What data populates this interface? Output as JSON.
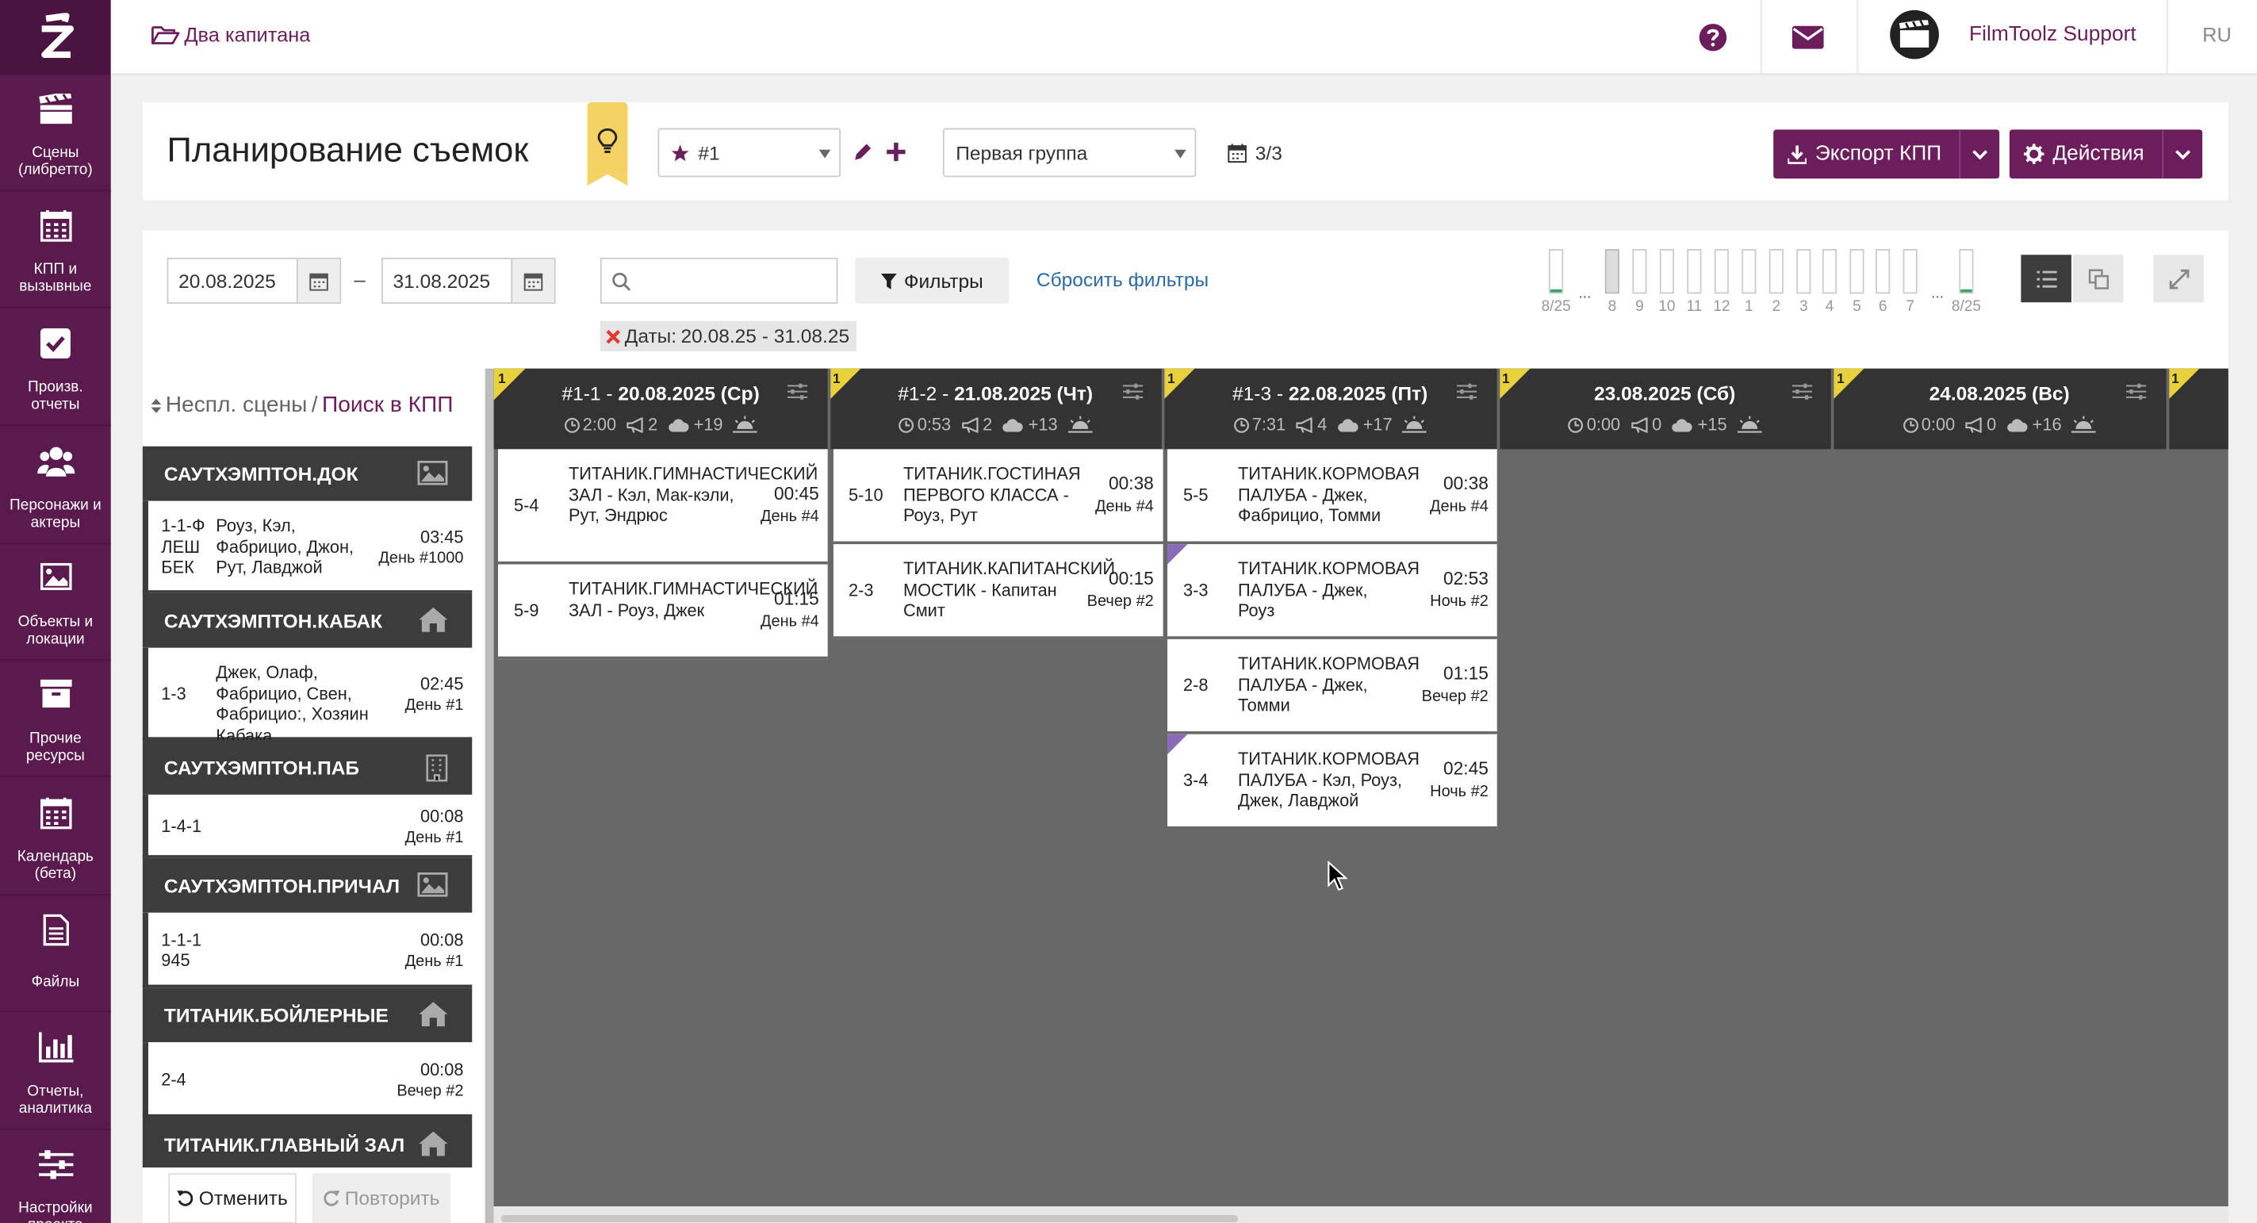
{
  "app": {
    "project": "Два капитана",
    "user": "FilmToolz Support",
    "lang": "RU"
  },
  "nav": [
    {
      "label": "Сцены (либретто)",
      "icon": "clapperboard-icon"
    },
    {
      "label": "КПП и вызывные",
      "icon": "calendar-grid-icon"
    },
    {
      "label": "Произв. отчеты",
      "icon": "checkbox-icon"
    },
    {
      "label": "Персонажи и актеры",
      "icon": "people-icon"
    },
    {
      "label": "Объекты и локации",
      "icon": "image-icon"
    },
    {
      "label": "Прочие ресурсы",
      "icon": "archive-icon"
    },
    {
      "label": "Календарь (бета)",
      "icon": "calendar-icon"
    },
    {
      "label": "Файлы",
      "icon": "file-icon"
    },
    {
      "label": "Отчеты, аналитика",
      "icon": "bar-chart-icon"
    },
    {
      "label": "Настройки проекта",
      "icon": "sliders-icon"
    }
  ],
  "header": {
    "title": "Планирование съемок",
    "version": "#1",
    "group": "Первая группа",
    "days_count": "3/3",
    "export_label": "Экспорт КПП",
    "actions_label": "Действия"
  },
  "toolbar": {
    "date_from": "20.08.2025",
    "date_dash": "–",
    "date_to": "31.08.2025",
    "search_placeholder": "",
    "filters_label": "Фильтры",
    "reset_label": "Сбросить фильтры",
    "chip_label": "Даты:",
    "chip_value": "20.08.25 - 31.08.25",
    "minimap_labels": [
      "8/25",
      "8",
      "9",
      "10",
      "11",
      "12",
      "1",
      "2",
      "3",
      "4",
      "5",
      "6",
      "7",
      "8/25"
    ],
    "minimap_ellipsis": "..."
  },
  "unplaced": {
    "title": "Неспл. сцены",
    "sep": "/",
    "link": "Поиск в КПП",
    "groups": [
      {
        "name": "САУТХЭМПТОН.ДОК",
        "icon": "image-icon",
        "items": [
          {
            "num": "1-1-Ф ЛЕШ БЕК",
            "desc": "Роуз, Кэл, Фабрицио, Джон, Рут, Лавджой",
            "time": "03:45",
            "tod": "День #1000"
          }
        ]
      },
      {
        "name": "САУТХЭМПТОН.КАБАК",
        "icon": "home-icon",
        "items": [
          {
            "num": "1-3",
            "desc": "Джек, Олаф, Фабрицио, Свен, Фабрицио:, Хозяин Кабака",
            "time": "02:45",
            "tod": "День #1"
          }
        ]
      },
      {
        "name": "САУТХЭМПТОН.ПАБ",
        "icon": "building-icon",
        "items": [
          {
            "num": "1-4-1",
            "desc": "",
            "time": "00:08",
            "tod": "День #1"
          }
        ]
      },
      {
        "name": "САУТХЭМПТОН.ПРИЧАЛ",
        "icon": "image-icon",
        "items": [
          {
            "num": "1-1-1 945",
            "desc": "",
            "time": "00:08",
            "tod": "День #1"
          }
        ]
      },
      {
        "name": "ТИТАНИК.БОЙЛЕРНЫЕ",
        "icon": "home-icon",
        "items": [
          {
            "num": "2-4",
            "desc": "",
            "time": "00:08",
            "tod": "Вечер #2"
          }
        ]
      },
      {
        "name": "ТИТАНИК.ГЛАВНЫЙ ЗАЛ",
        "icon": "home-icon",
        "items": []
      }
    ],
    "undo_label": "Отменить",
    "redo_label": "Повторить"
  },
  "days": [
    {
      "badge": "1",
      "prefix": "#1-1 - ",
      "date": "20.08.2025 (Ср)",
      "duration": "2:00",
      "scenes": "2",
      "weather": "+19",
      "cards": [
        {
          "num": "5-4",
          "desc": "ТИТАНИК.ГИМНАСТИЧЕСКИЙ ЗАЛ - Кэл, Мак-кэли, Рут, Эндрюс",
          "time": "00:45",
          "tod": "День #4",
          "mark": false
        },
        {
          "num": "5-9",
          "desc": "ТИТАНИК.ГИМНАСТИЧЕСКИЙ ЗАЛ - Роуз, Джек",
          "time": "01:15",
          "tod": "День #4",
          "mark": false
        }
      ]
    },
    {
      "badge": "1",
      "prefix": "#1-2 - ",
      "date": "21.08.2025 (Чт)",
      "duration": "0:53",
      "scenes": "2",
      "weather": "+13",
      "cards": [
        {
          "num": "5-10",
          "desc": "ТИТАНИК.ГОСТИНАЯ ПЕРВОГО КЛАССА - Роуз, Рут",
          "time": "00:38",
          "tod": "День #4",
          "mark": false
        },
        {
          "num": "2-3",
          "desc": "ТИТАНИК.КАПИТАНСКИЙ МОСТИК - Капитан Смит",
          "time": "00:15",
          "tod": "Вечер #2",
          "mark": false
        }
      ]
    },
    {
      "badge": "1",
      "prefix": "#1-3 - ",
      "date": "22.08.2025 (Пт)",
      "duration": "7:31",
      "scenes": "4",
      "weather": "+17",
      "cards": [
        {
          "num": "5-5",
          "desc": "ТИТАНИК.КОРМОВАЯ ПАЛУБА - Джек, Фабрицио, Томми",
          "time": "00:38",
          "tod": "День #4",
          "mark": false
        },
        {
          "num": "3-3",
          "desc": "ТИТАНИК.КОРМОВАЯ ПАЛУБА - Джек, Роуз",
          "time": "02:53",
          "tod": "Ночь #2",
          "mark": true
        },
        {
          "num": "2-8",
          "desc": "ТИТАНИК.КОРМОВАЯ ПАЛУБА - Джек, Томми",
          "time": "01:15",
          "tod": "Вечер #2",
          "mark": false
        },
        {
          "num": "3-4",
          "desc": "ТИТАНИК.КОРМОВАЯ ПАЛУБА - Кэл, Роуз, Джек, Лавджой",
          "time": "02:45",
          "tod": "Ночь #2",
          "mark": true
        }
      ]
    },
    {
      "badge": "1",
      "prefix": "",
      "date": "23.08.2025 (Сб)",
      "duration": "0:00",
      "scenes": "0",
      "weather": "+15",
      "cards": []
    },
    {
      "badge": "1",
      "prefix": "",
      "date": "24.08.2025 (Вс)",
      "duration": "0:00",
      "scenes": "0",
      "weather": "+16",
      "cards": []
    },
    {
      "badge": "1",
      "prefix": "",
      "date": "",
      "duration": "",
      "scenes": "",
      "weather": "",
      "cards": []
    }
  ],
  "colors": {
    "brand": "#6b1d5c",
    "sidebar": "#5b1a4e",
    "board": "#686868",
    "header_dark": "#333333",
    "badge": "#e8d13a",
    "mark": "#8a6bb8"
  }
}
